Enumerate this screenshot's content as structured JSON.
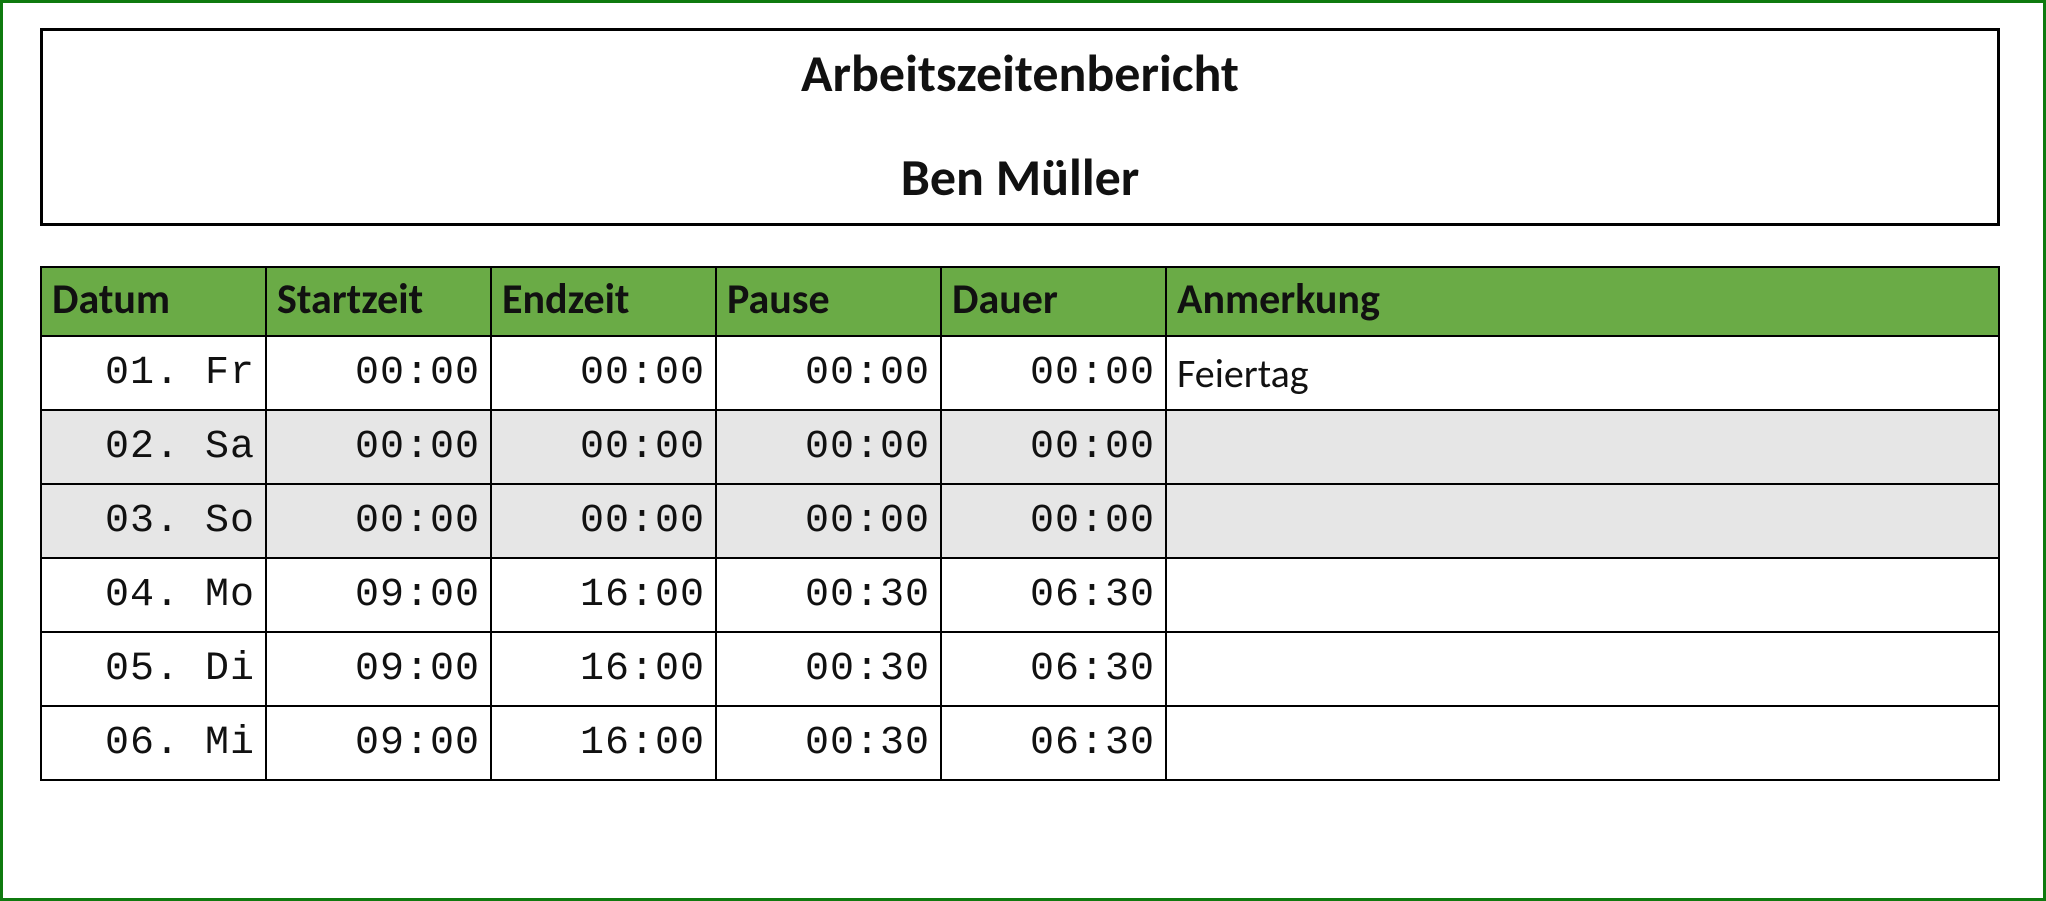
{
  "header": {
    "title": "Arbeitszeitenbericht",
    "employee": "Ben Müller"
  },
  "table": {
    "columns": {
      "date": "Datum",
      "start": "Startzeit",
      "end": "Endzeit",
      "pause": "Pause",
      "duration": "Dauer",
      "note": "Anmerkung"
    },
    "rows": [
      {
        "date": "01. Fr",
        "start": "00:00",
        "end": "00:00",
        "pause": "00:00",
        "duration": "00:00",
        "note": "Feiertag",
        "shaded": false
      },
      {
        "date": "02. Sa",
        "start": "00:00",
        "end": "00:00",
        "pause": "00:00",
        "duration": "00:00",
        "note": "",
        "shaded": true
      },
      {
        "date": "03. So",
        "start": "00:00",
        "end": "00:00",
        "pause": "00:00",
        "duration": "00:00",
        "note": "",
        "shaded": true
      },
      {
        "date": "04. Mo",
        "start": "09:00",
        "end": "16:00",
        "pause": "00:30",
        "duration": "06:30",
        "note": "",
        "shaded": false
      },
      {
        "date": "05. Di",
        "start": "09:00",
        "end": "16:00",
        "pause": "00:30",
        "duration": "06:30",
        "note": "",
        "shaded": false
      },
      {
        "date": "06. Mi",
        "start": "09:00",
        "end": "16:00",
        "pause": "00:30",
        "duration": "06:30",
        "note": "",
        "shaded": false
      }
    ]
  }
}
